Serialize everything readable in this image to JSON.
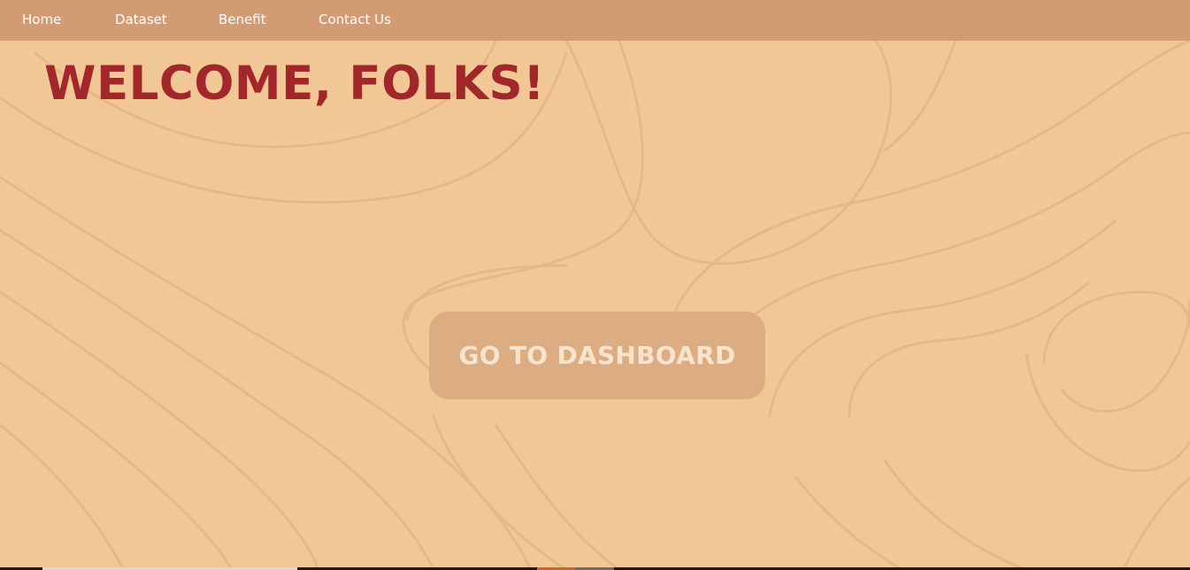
{
  "nav": {
    "items": [
      {
        "label": "Home"
      },
      {
        "label": "Dataset"
      },
      {
        "label": "Benefit"
      },
      {
        "label": "Contact Us"
      }
    ]
  },
  "hero": {
    "title": "WELCOME, FOLKS!",
    "button_label": "GO TO DASHBOARD"
  },
  "colors": {
    "background": "#f2c796",
    "navbar": "#d39b74",
    "title": "#a1272b",
    "button_bg": "#dcac82",
    "button_text": "#f8e3cd"
  }
}
